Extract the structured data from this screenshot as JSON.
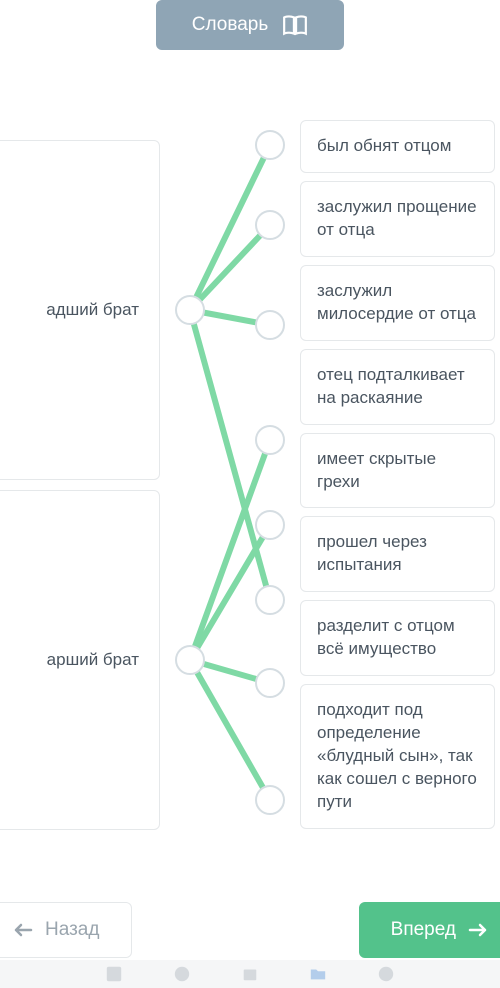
{
  "header": {
    "dictionary_label": "Словарь"
  },
  "left_items": [
    {
      "label": "адший брат"
    },
    {
      "label": "арший брат"
    }
  ],
  "right_items": [
    {
      "label": "был обнят отцом"
    },
    {
      "label": "заслужил прощение от отца"
    },
    {
      "label": "заслужил милосердие от отца"
    },
    {
      "label": "отец подталкивает на раскаяние"
    },
    {
      "label": "имеет скрытые грехи"
    },
    {
      "label": "прошел через испытания"
    },
    {
      "label": "разделит с отцом всё имущество"
    },
    {
      "label": "подходит под определение «блудный сын», так как сошел с верного пути"
    }
  ],
  "connections": [
    {
      "from": 0,
      "to": 0
    },
    {
      "from": 0,
      "to": 1
    },
    {
      "from": 0,
      "to": 2
    },
    {
      "from": 0,
      "to": 5
    },
    {
      "from": 1,
      "to": 3
    },
    {
      "from": 1,
      "to": 4
    },
    {
      "from": 1,
      "to": 6
    },
    {
      "from": 1,
      "to": 7
    }
  ],
  "nav": {
    "back_label": "Назад",
    "forward_label": "Вперед"
  },
  "colors": {
    "line": "#7fd9a5",
    "header_btn": "#8fa5b5",
    "forward_btn": "#53c28b"
  }
}
